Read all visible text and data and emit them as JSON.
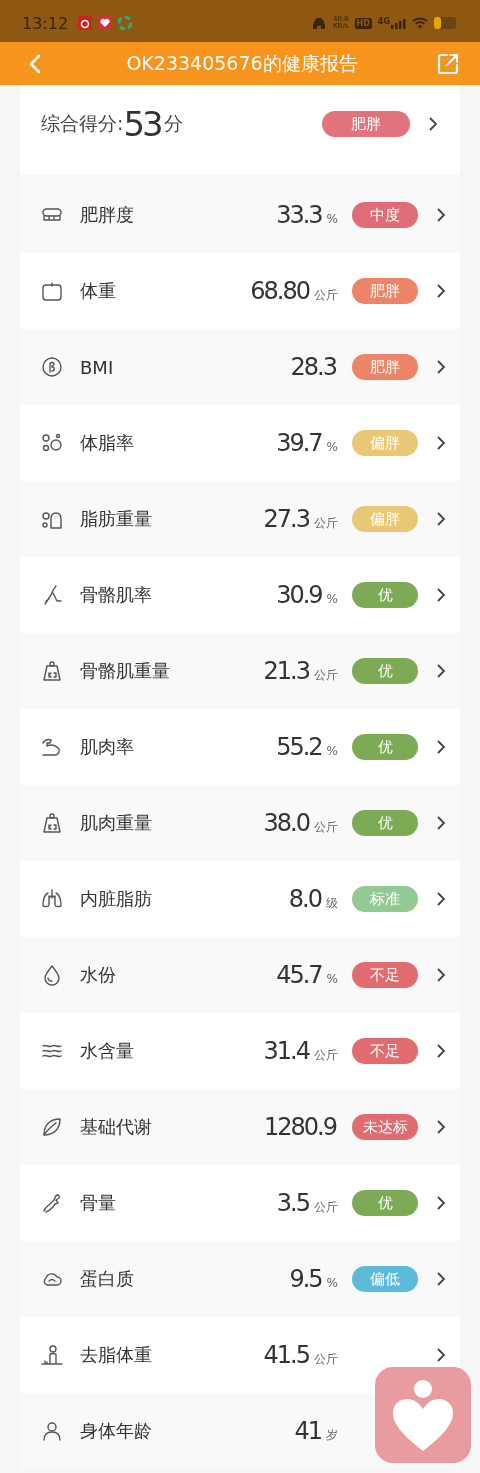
{
  "status_bar": {
    "time": "13:12",
    "speed": "40.8",
    "speed_unit": "KB/s",
    "hd": "HD",
    "network": "4G"
  },
  "header": {
    "title": "OK233405676的健康报告"
  },
  "score": {
    "label": "综合得分:",
    "value": "53",
    "unit": "分",
    "badge": {
      "text": "肥胖",
      "color": "#e0737c"
    }
  },
  "metrics": [
    {
      "label": "肥胖度",
      "value": "33.3",
      "unit": "%",
      "badge": {
        "text": "中度",
        "color": "#e06c78"
      }
    },
    {
      "label": "体重",
      "value": "68.80",
      "unit": "公斤",
      "badge": {
        "text": "肥胖",
        "color": "#ec8468"
      }
    },
    {
      "label": "BMI",
      "value": "28.3",
      "badge": {
        "text": "肥胖",
        "color": "#ec8468"
      }
    },
    {
      "label": "体脂率",
      "value": "39.7",
      "unit": "%",
      "badge": {
        "text": "偏胖",
        "color": "#e8c874"
      }
    },
    {
      "label": "脂肪重量",
      "value": "27.3",
      "unit": "公斤",
      "badge": {
        "text": "偏胖",
        "color": "#e8c874"
      }
    },
    {
      "label": "骨骼肌率",
      "value": "30.9",
      "unit": "%",
      "badge": {
        "text": "优",
        "color": "#7daa55"
      }
    },
    {
      "label": "骨骼肌重量",
      "value": "21.3",
      "unit": "公斤",
      "badge": {
        "text": "优",
        "color": "#7daa55"
      }
    },
    {
      "label": "肌肉率",
      "value": "55.2",
      "unit": "%",
      "badge": {
        "text": "优",
        "color": "#7daa55"
      }
    },
    {
      "label": "肌肉重量",
      "value": "38.0",
      "unit": "公斤",
      "badge": {
        "text": "优",
        "color": "#7daa55"
      }
    },
    {
      "label": "内脏脂肪",
      "value": "8.0",
      "unit": "级",
      "badge": {
        "text": "标准",
        "color": "#93c993"
      }
    },
    {
      "label": "水份",
      "value": "45.7",
      "unit": "%",
      "badge": {
        "text": "不足",
        "color": "#e06c70"
      }
    },
    {
      "label": "水含量",
      "value": "31.4",
      "unit": "公斤",
      "badge": {
        "text": "不足",
        "color": "#e06c70"
      }
    },
    {
      "label": "基础代谢",
      "value": "1280.9",
      "badge": {
        "text": "未达标",
        "color": "#e06c70"
      }
    },
    {
      "label": "骨量",
      "value": "3.5",
      "unit": "公斤",
      "badge": {
        "text": "优",
        "color": "#7daa55"
      }
    },
    {
      "label": "蛋白质",
      "value": "9.5",
      "unit": "%",
      "badge": {
        "text": "偏低",
        "color": "#5bbbd8"
      }
    },
    {
      "label": "去脂体重",
      "value": "41.5",
      "unit": "公斤"
    },
    {
      "label": "身体年龄",
      "value": "41",
      "unit": "岁"
    }
  ]
}
